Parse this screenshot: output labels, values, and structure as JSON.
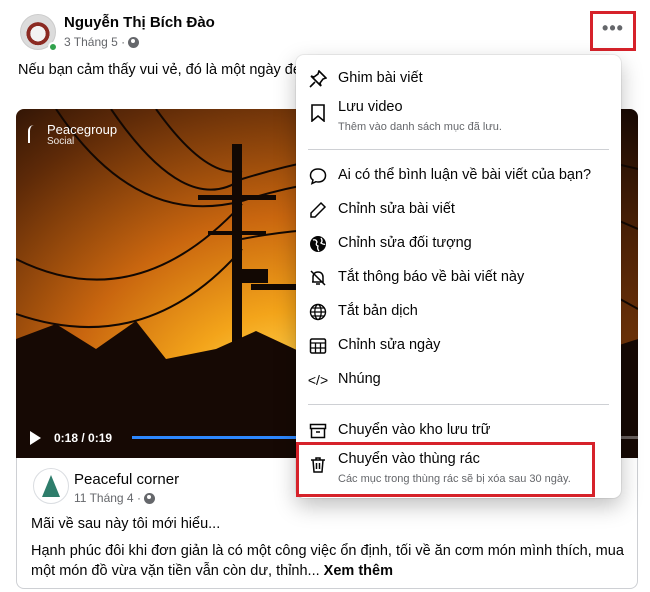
{
  "post": {
    "author": "Nguyễn Thị Bích Đào",
    "date": "3 Tháng 5 ·",
    "text": "Nếu bạn cảm thấy vui vẻ, đó là một ngày đẹ                                                                                   y đẹp trời, chỉ là người thưởng thức không cò"
  },
  "video": {
    "brand_name": "Peacegroup",
    "brand_sub": "Social",
    "time": "0:18 / 0:19",
    "progress": 0.95
  },
  "shared": {
    "page_name": "Peaceful corner",
    "date": "11 Tháng 4 ·",
    "quote": "Mãi về sau này tôi mới hiểu...",
    "text": "Hạnh phúc đôi khi đơn giản là có một công việc ổn định, tối về ăn cơm món mình thích, mua một món đồ vừa vặn tiền vẫn còn dư, thỉnh... ",
    "see_more": "Xem thêm"
  },
  "menu": {
    "pin": "Ghim bài viết",
    "save_video": "Lưu video",
    "save_video_sub": "Thêm vào danh sách mục đã lưu.",
    "who_comment": "Ai có thể bình luận về bài viết của bạn?",
    "edit_post": "Chỉnh sửa bài viết",
    "edit_audience": "Chỉnh sửa đối tượng",
    "mute_notifications": "Tắt thông báo về bài viết này",
    "turn_off_translation": "Tắt bản dịch",
    "edit_date": "Chỉnh sửa ngày",
    "embed": "Nhúng",
    "archive": "Chuyển vào kho lưu trữ",
    "trash": "Chuyển vào thùng rác",
    "trash_sub": "Các mục trong thùng rác sẽ bị xóa sau 30 ngày."
  },
  "colors": {
    "highlight": "#d6222a",
    "progress": "#2d88ff",
    "online": "#31a24c"
  },
  "icons": [
    "pin-icon",
    "bookmark-icon",
    "comment-icon",
    "pencil-icon",
    "globe-icon",
    "bell-off-icon",
    "translate-globe-icon",
    "calendar-icon",
    "code-icon",
    "archive-icon",
    "trash-icon"
  ]
}
